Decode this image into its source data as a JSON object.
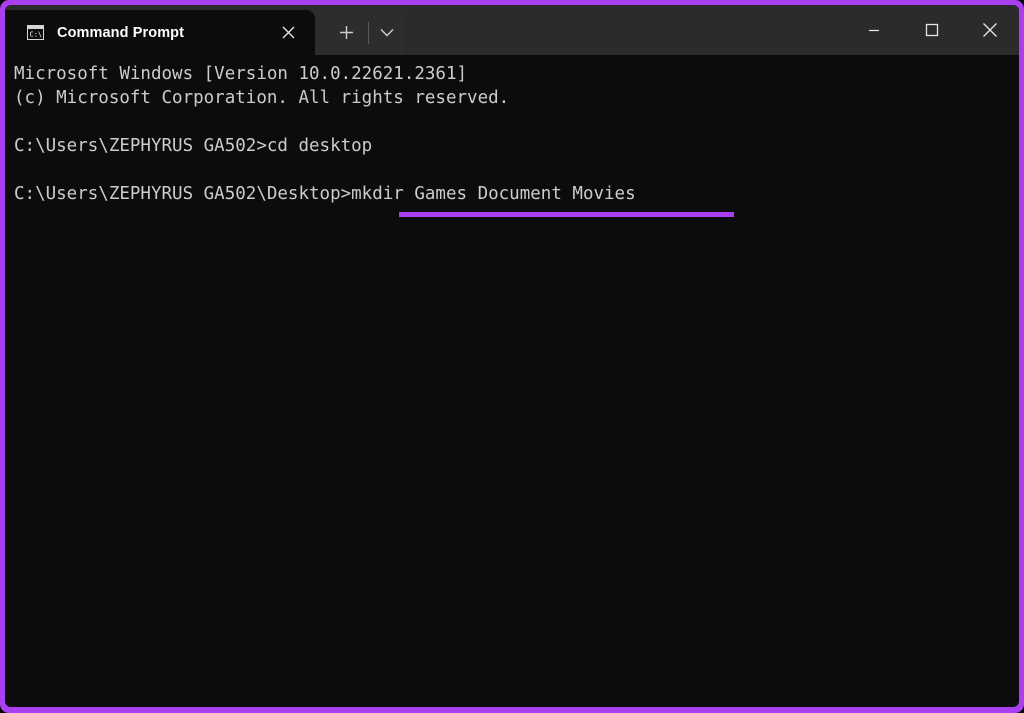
{
  "window": {
    "frame_color": "#a93ff0",
    "titlebar_color": "#2b2b2b",
    "terminal_background": "#0c0c0c",
    "terminal_foreground": "#cccccc"
  },
  "titlebar": {
    "tab": {
      "label": "Command Prompt",
      "icon": "console-icon",
      "icon_text": "C:\\",
      "close_icon": "close-icon",
      "close_label": "Close tab"
    },
    "new_tab": {
      "icon": "plus-icon",
      "label": "New tab"
    },
    "tab_dropdown": {
      "icon": "chevron-down-icon",
      "label": "Open new tab dropdown"
    },
    "controls": [
      {
        "name": "minimize-button",
        "icon": "minimize-icon",
        "label": "Minimize"
      },
      {
        "name": "maximize-button",
        "icon": "maximize-icon",
        "label": "Maximize"
      },
      {
        "name": "close-button",
        "icon": "close-icon",
        "label": "Close"
      }
    ]
  },
  "terminal": {
    "lines": [
      "Microsoft Windows [Version 10.0.22621.2361]",
      "(c) Microsoft Corporation. All rights reserved.",
      "",
      "C:\\Users\\ZEPHYRUS GA502>cd desktop",
      "",
      "C:\\Users\\ZEPHYRUS GA502\\Desktop>mkdir Games Document Movies"
    ],
    "highlight": {
      "text": "mkdir Games Document Movies",
      "color": "#a93ff0"
    }
  }
}
